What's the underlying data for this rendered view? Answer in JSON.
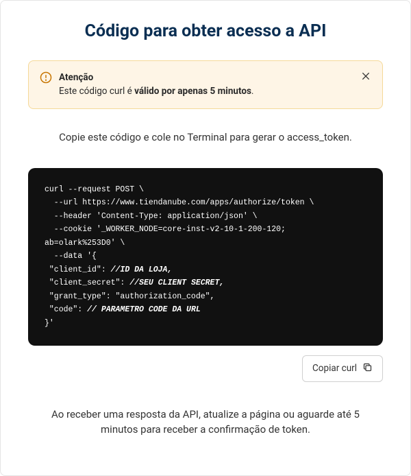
{
  "title": "Código para obter acesso a API",
  "alert": {
    "title": "Atenção",
    "text_prefix": "Este código curl é ",
    "text_bold": "válido por apenas 5 minutos",
    "text_suffix": "."
  },
  "instruction": "Copie este código e cole no Terminal para gerar o access_token.",
  "code": {
    "l1": "curl --request POST \\",
    "l2": "  --url https://www.tiendanube.com/apps/authorize/token \\",
    "l3": "  --header 'Content-Type: application/json' \\",
    "l4": "  --cookie '_WORKER_NODE=core-inst-v2-10-1-200-120;",
    "l5": "ab=olark%253D0' \\",
    "l6": "  --data '{",
    "l7a": " \"client_id\": ",
    "l7b": "//ID DA LOJA,",
    "l8a": " \"client_secret\": ",
    "l8b": "//SEU CLIENT SECRET,",
    "l9": " \"grant_type\": \"authorization_code\",",
    "l10a": " \"code\": ",
    "l10b": "// PARAMETRO CODE DA URL",
    "l11": "}'"
  },
  "copy_button": "Copiar curl",
  "footer": "Ao receber uma resposta da API, atualize a página ou aguarde até 5 minutos para receber a confirmação de token."
}
